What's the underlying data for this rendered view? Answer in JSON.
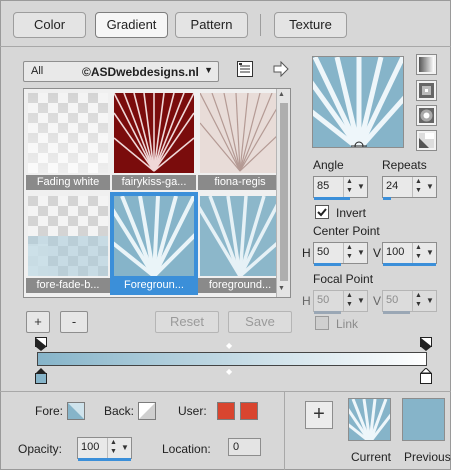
{
  "tabs": [
    {
      "label": "Color",
      "active": false
    },
    {
      "label": "Gradient",
      "active": true
    },
    {
      "label": "Pattern",
      "active": false
    },
    {
      "label": "Texture",
      "active": false
    }
  ],
  "library": {
    "category": "All",
    "watermark": "©ASDwebdesigns.nl"
  },
  "gradients": [
    {
      "name": "Fading white",
      "selected": false
    },
    {
      "name": "fairykiss-ga...",
      "selected": false
    },
    {
      "name": "fiona-regis",
      "selected": false
    },
    {
      "name": "fore-fade-b...",
      "selected": false
    },
    {
      "name": "Foregroun...",
      "selected": true
    },
    {
      "name": "foreground...",
      "selected": false
    }
  ],
  "buttons": {
    "add": "+",
    "remove": "-",
    "reset": "Reset",
    "save": "Save"
  },
  "angle": {
    "label": "Angle",
    "value": "85"
  },
  "repeats": {
    "label": "Repeats",
    "value": "24"
  },
  "invert": {
    "label": "Invert",
    "checked": true
  },
  "center_point": {
    "label": "Center Point",
    "h_label": "H",
    "h": "50",
    "v_label": "V",
    "v": "100"
  },
  "focal_point": {
    "label": "Focal Point",
    "h_label": "H",
    "h": "50",
    "v_label": "V",
    "v": "50"
  },
  "link": {
    "label": "Link",
    "checked": false
  },
  "bottom": {
    "fore_label": "Fore:",
    "back_label": "Back:",
    "user_label": "User:",
    "opacity_label": "Opacity:",
    "opacity": "100",
    "location_label": "Location:",
    "location": "0",
    "user_color_1": "#d9452f",
    "user_color_2": "#d9452f"
  },
  "preview": {
    "current_label": "Current",
    "previous_label": "Previous",
    "add_label": "+"
  },
  "colors": {
    "accent": "#3b8fd9",
    "gradient_light": "#ffffff",
    "gradient_blue": "#86b4c9"
  }
}
